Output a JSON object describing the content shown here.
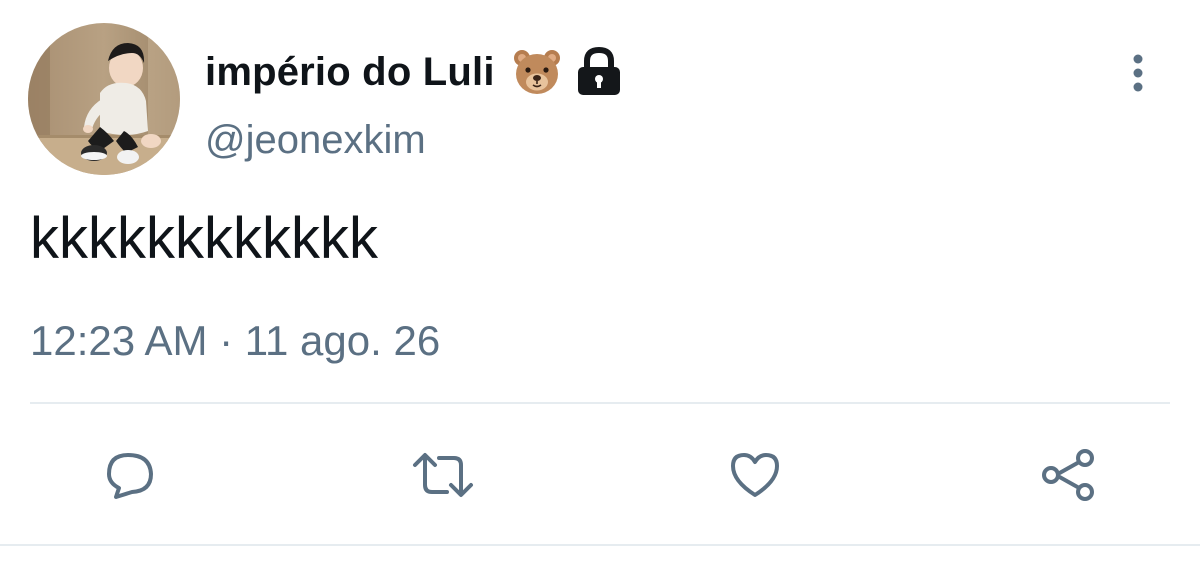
{
  "author": {
    "display_name": "império do Luli",
    "handle": "@jeonexkim",
    "badges": [
      "bear-emoji",
      "lock-icon"
    ]
  },
  "tweet": {
    "text": "kkkkkkkkkkkk",
    "timestamp": "12:23 AM · 11 ago. 26"
  },
  "actions": [
    "reply-icon",
    "retweet-icon",
    "like-icon",
    "share-icon"
  ],
  "colors": {
    "text": "#0f1419",
    "secondary": "#5b7083",
    "divider": "#e6ecf0",
    "background": "#ffffff"
  }
}
